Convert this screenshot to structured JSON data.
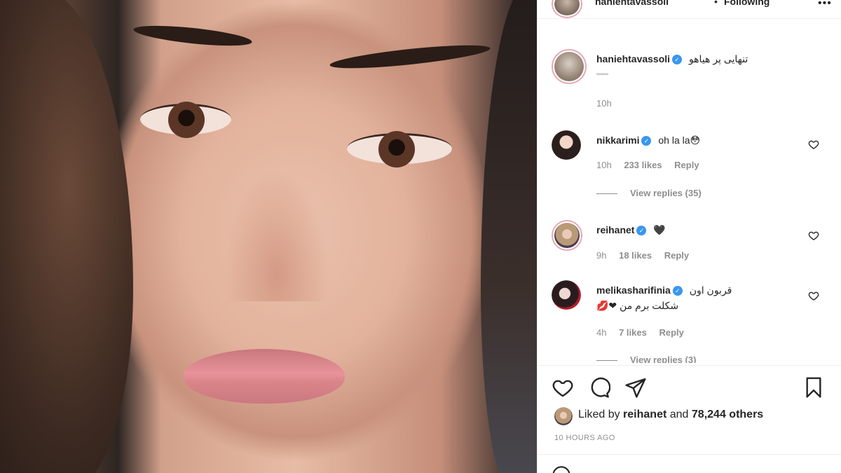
{
  "post": {
    "author": "haniehtavassoli",
    "following_label": "Following",
    "separator": "•",
    "more": "•••"
  },
  "caption": {
    "username": "haniehtavassoli",
    "text": "تنهایی پر هیاهو",
    "quote_line": "\"\"\"\"",
    "time": "10h"
  },
  "comments": [
    {
      "username": "nikkarimi",
      "text": "oh la la😳",
      "time": "10h",
      "likes": "233 likes",
      "reply": "Reply",
      "view_replies": "View replies (35)"
    },
    {
      "username": "reihanet",
      "text": "🖤",
      "time": "9h",
      "likes": "18 likes",
      "reply": "Reply"
    },
    {
      "username": "melikasharifinia",
      "text": "قربون اون",
      "text_line2": "شکلت برم من ❤💋",
      "time": "4h",
      "likes": "7 likes",
      "reply": "Reply",
      "view_replies": "View replies (3)"
    }
  ],
  "likes_summary": {
    "prefix": "Liked by",
    "user": "reihanet",
    "joiner": "and",
    "count": "78,244 others"
  },
  "post_time": "10 HOURS AGO",
  "colors": {
    "verified": "#3897f0",
    "muted_text": "#8e8e8e",
    "primary_text": "#262626",
    "story_ring": "#e6a9b4"
  },
  "icons": {
    "like": "heart-icon",
    "comment": "comment-bubble-icon",
    "share": "paper-plane-icon",
    "save": "bookmark-icon",
    "verified": "verified-badge-icon",
    "comment_like": "small-heart-icon",
    "more": "more-options-icon"
  }
}
